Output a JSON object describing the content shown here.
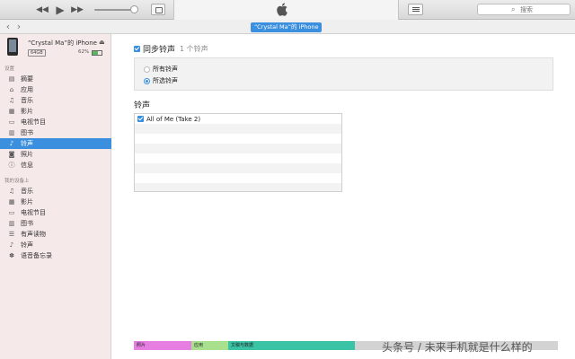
{
  "toolbar": {
    "prev_icon": "rewind-icon",
    "play_icon": "play-icon",
    "next_icon": "fast-forward-icon",
    "volume_level": 0.85,
    "apple_icon": "apple-logo-icon",
    "list_icon": "list-icon",
    "search_placeholder": "搜索"
  },
  "navbar": {
    "back_glyph": "‹",
    "forward_glyph": "›",
    "device_pill": "“Crystal Ma”的 iPhone"
  },
  "sidebar": {
    "device_name": "“Crystal Ma”的 iPhone",
    "eject_glyph": "⏏",
    "capacity": "64GB",
    "battery_text": "62% ",
    "battery_level": 0.62,
    "settings_header": "设置",
    "settings_items": [
      {
        "label": "摘要",
        "icon": "summary-icon"
      },
      {
        "label": "应用",
        "icon": "apps-icon"
      },
      {
        "label": "音乐",
        "icon": "music-icon"
      },
      {
        "label": "影片",
        "icon": "movies-icon"
      },
      {
        "label": "电视节目",
        "icon": "tv-icon"
      },
      {
        "label": "图书",
        "icon": "books-icon"
      },
      {
        "label": "铃声",
        "icon": "bell-icon",
        "active": true
      },
      {
        "label": "照片",
        "icon": "camera-icon"
      },
      {
        "label": "信息",
        "icon": "info-icon"
      }
    ],
    "ondevice_header": "我的设备上",
    "ondevice_items": [
      {
        "label": "音乐",
        "icon": "music-icon"
      },
      {
        "label": "影片",
        "icon": "movies-icon"
      },
      {
        "label": "电视节目",
        "icon": "tv-icon"
      },
      {
        "label": "图书",
        "icon": "books-icon"
      },
      {
        "label": "有声读物",
        "icon": "audiobooks-icon"
      },
      {
        "label": "铃声",
        "icon": "bell-icon"
      },
      {
        "label": "语音备忘录",
        "icon": "voice-memo-icon"
      }
    ]
  },
  "main": {
    "sync_label": "同步铃声",
    "sync_count": "1 个铃声",
    "sync_checked": true,
    "option_all": "所有铃声",
    "option_selected": "所选铃声",
    "selected_option": "所选铃声",
    "ringtones_title": "铃声",
    "ringtones": [
      {
        "name": "All of Me (Take 2)",
        "checked": true
      }
    ]
  },
  "capacity_bar": {
    "photos": "照片",
    "apps": "应用",
    "docs": "文稿与数据",
    "colors": {
      "photos": "#e77ee2",
      "apps": "#a9e08d",
      "docs": "#3bc3a6",
      "other": "#d3d3d3"
    }
  },
  "watermark": "头条号 / 未来手机就是什么样的",
  "colors": {
    "accent": "#3a8fde",
    "sidebar_bg": "#f6e9e9"
  }
}
